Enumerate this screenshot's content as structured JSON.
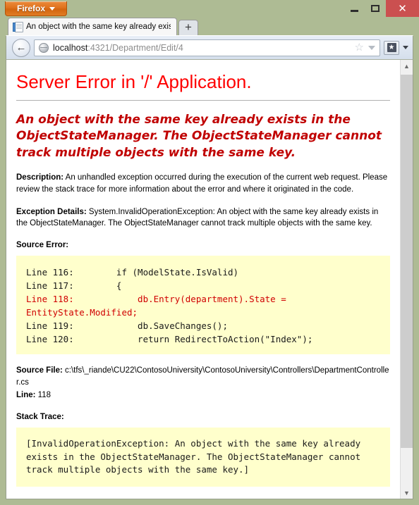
{
  "window": {
    "app_button_label": "Firefox",
    "controls": {
      "minimize": "–",
      "maximize": "□",
      "close": "✕"
    }
  },
  "tabs": [
    {
      "title": "An object with the same key already exis...",
      "favicon": "document-icon",
      "active": true
    }
  ],
  "new_tab_label": "+",
  "toolbar": {
    "back_glyph": "←",
    "url_host": "localhost",
    "url_rest": ":4321/Department/Edit/4",
    "url_full": "localhost:4321/Department/Edit/4",
    "star_glyph": "☆",
    "bookmark_glyph": "★"
  },
  "scrollbar": {
    "up_glyph": "▲",
    "down_glyph": "▼"
  },
  "page": {
    "title": "Server Error in '/' Application.",
    "message": "An object with the same key already exists in the ObjectStateManager. The ObjectStateManager cannot track multiple objects with the same key.",
    "description_label": "Description:",
    "description_text": " An unhandled exception occurred during the execution of the current web request. Please review the stack trace for more information about the error and where it originated in the code.",
    "exception_label": "Exception Details:",
    "exception_text": " System.InvalidOperationException: An object with the same key already exists in the ObjectStateManager. The ObjectStateManager cannot track multiple objects with the same key.",
    "source_error_head": "Source Error:",
    "source_code": {
      "lines": [
        {
          "text": "Line 116:        if (ModelState.IsValid)",
          "highlight": false
        },
        {
          "text": "Line 117:        {",
          "highlight": false
        },
        {
          "text": "Line 118:            db.Entry(department).State = EntityState.Modified;",
          "highlight": true
        },
        {
          "text": "Line 119:            db.SaveChanges();",
          "highlight": false
        },
        {
          "text": "Line 120:            return RedirectToAction(\"Index\");",
          "highlight": false
        }
      ]
    },
    "source_file_label": "Source File:",
    "source_file_value": " c:\\tfs\\_riande\\CU22\\ContosoUniversity\\ContosoUniversity\\Controllers\\DepartmentController.cs",
    "line_label": "Line:",
    "line_value": " 118",
    "stack_trace_head": "Stack Trace:",
    "stack_trace_text": "[InvalidOperationException: An object with the same key already exists in the ObjectStateManager. The ObjectStateManager cannot track multiple objects with the same key.]"
  }
}
